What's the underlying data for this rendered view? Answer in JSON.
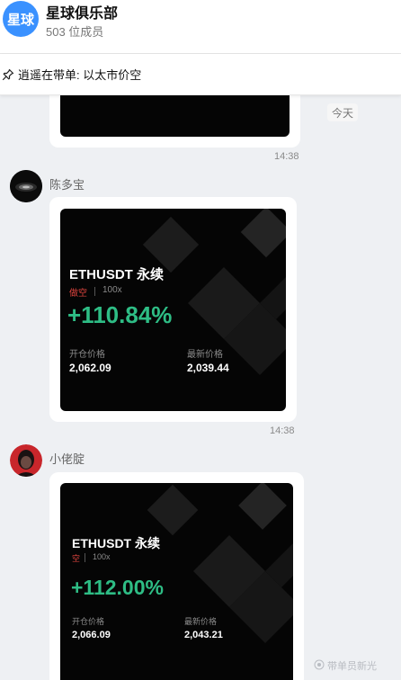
{
  "header": {
    "group_avatar_text": "星球",
    "group_name": "星球俱乐部",
    "member_count": "503 位成员"
  },
  "pinned": {
    "icon": "pin-icon",
    "text": "逍遥在带单: 以太市价空"
  },
  "chat": {
    "date_badge": "今天",
    "messages": [
      {
        "time": "14:38"
      },
      {
        "sender": "陈多宝",
        "time": "14:38",
        "card": {
          "title": "ETHUSDT 永续",
          "side": "做空",
          "leverage": "100x",
          "pnl_percent": "+110.84%",
          "entry_label": "开仓价格",
          "entry_price": "2,062.09",
          "latest_label": "最新价格",
          "latest_price": "2,039.44"
        }
      },
      {
        "sender": "小佬腚",
        "card": {
          "title": "ETHUSDT 永续",
          "side": "空",
          "leverage": "100x",
          "pnl_percent": "+112.00%",
          "entry_label": "开仓价格",
          "entry_price": "2,066.09",
          "latest_label": "最新价格",
          "latest_price": "2,043.21"
        }
      }
    ]
  },
  "watermark": "带单员新光",
  "colors": {
    "profit_green": "#2ebd85",
    "short_red": "#e0453f",
    "group_avatar_blue": "#3a91ff"
  }
}
